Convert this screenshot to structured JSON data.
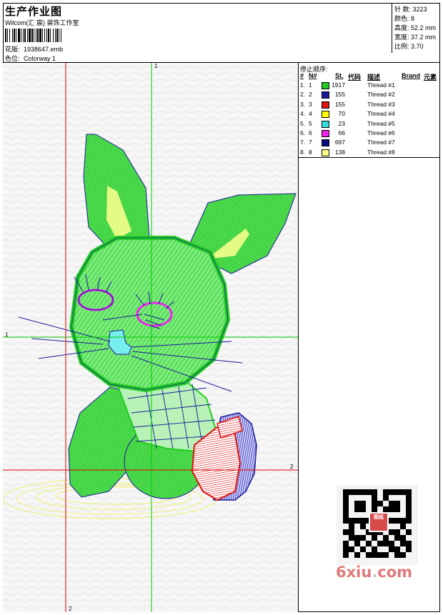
{
  "header": {
    "title": "生产作业图",
    "company": "Wilcom(汇 宸) 装饰工作室",
    "design_label": "花版:",
    "design_value": "1938647.emb",
    "colorway_label": "色位:",
    "colorway_value": "Colorway 1"
  },
  "stats": [
    {
      "label": "针 数:",
      "value": "3223"
    },
    {
      "label": "颜色:",
      "value": "8"
    },
    {
      "label": "高度:",
      "value": "52.2 mm"
    },
    {
      "label": "宽度:",
      "value": "37.2 mm"
    },
    {
      "label": "比例:",
      "value": "3.70"
    }
  ],
  "stop_sequence": {
    "label": "停止顺序:",
    "columns": [
      "#",
      "N#",
      "St.",
      "代码",
      "描述",
      "Brand",
      "元素"
    ],
    "rows": [
      {
        "idx": "1.",
        "n": "1",
        "st": "1917",
        "desc": "Thread #1",
        "color": "#22cc22"
      },
      {
        "idx": "2.",
        "n": "2",
        "st": "155",
        "desc": "Thread #2",
        "color": "#1a1a9a"
      },
      {
        "idx": "3.",
        "n": "3",
        "st": "155",
        "desc": "Thread #3",
        "color": "#dd1111"
      },
      {
        "idx": "4.",
        "n": "4",
        "st": "70",
        "desc": "Thread #4",
        "color": "#ffff00"
      },
      {
        "idx": "5.",
        "n": "5",
        "st": "23",
        "desc": "Thread #5",
        "color": "#33dddd"
      },
      {
        "idx": "6.",
        "n": "6",
        "st": "66",
        "desc": "Thread #6",
        "color": "#ee22ee"
      },
      {
        "idx": "7.",
        "n": "7",
        "st": "697",
        "desc": "Thread #7",
        "color": "#0a0a80"
      },
      {
        "idx": "8.",
        "n": "8",
        "st": "138",
        "desc": "Thread #8",
        "color": "#ffff88"
      }
    ]
  },
  "guides": {
    "v1": "1",
    "h1": "1",
    "h2": "2",
    "v2": "2"
  },
  "watermark": {
    "pre": "6xiu",
    "mid": ".",
    "post": "com"
  },
  "qr_logo": "图纸"
}
